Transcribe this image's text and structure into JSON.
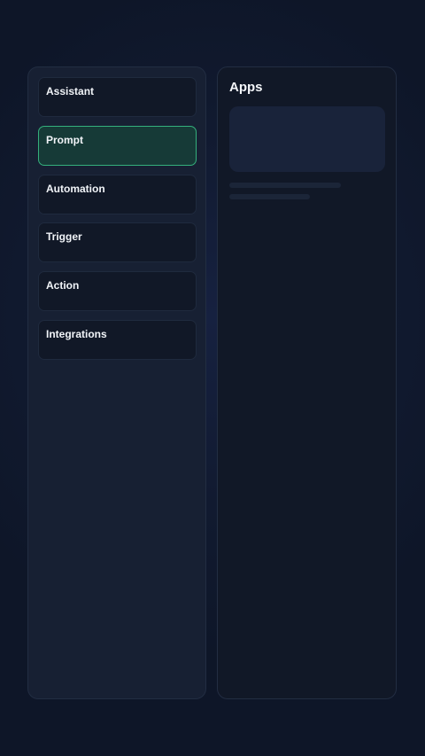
{
  "sidebar": {
    "items": [
      {
        "label": "Assistant",
        "active": false
      },
      {
        "label": "Prompt",
        "active": true
      },
      {
        "label": "Automation",
        "active": false
      },
      {
        "label": "Trigger",
        "active": false
      },
      {
        "label": "Action",
        "active": false
      },
      {
        "label": "Integrations",
        "active": false
      }
    ]
  },
  "main": {
    "title": "Apps"
  },
  "colors": {
    "background": "#0f1729",
    "panel": "#172033",
    "item": "#111827",
    "active_border": "#34b07c",
    "active_fill": "#163a37",
    "text": "#f1f4f8"
  }
}
